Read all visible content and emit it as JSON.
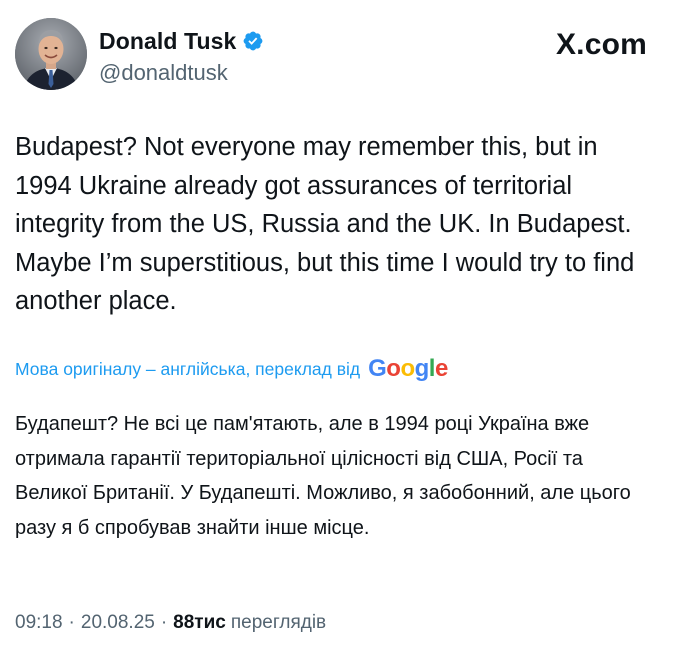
{
  "author": {
    "display_name": "Donald Tusk",
    "handle": "@donaldtusk",
    "verified": true,
    "verified_color": "#1d9bf0"
  },
  "brand": "X.com",
  "tweet": {
    "text": "Budapest? Not everyone may remember this, but in 1994 Ukraine already got assurances of territorial integrity from the US, Russia and the UK. In Budapest. Maybe I’m superstitious, but this time I would try to find another place."
  },
  "translation": {
    "label": "Мова оригіналу – англійська, переклад від",
    "provider": "Google",
    "text": "Будапешт? Не всі це пам'ятають, але в 1994 році Україна вже отримала гарантії територіальної цілісності від США, Росії та Великої Британії. У Будапешті. Можливо, я забобонний, але цього разу я б спробував знайти інше місце."
  },
  "meta": {
    "time": "09:18",
    "separator": "·",
    "date": "20.08.25",
    "views_count": "88тис",
    "views_label": "переглядів"
  },
  "colors": {
    "text": "#0f1419",
    "secondary": "#536471",
    "accent": "#1d9bf0"
  }
}
